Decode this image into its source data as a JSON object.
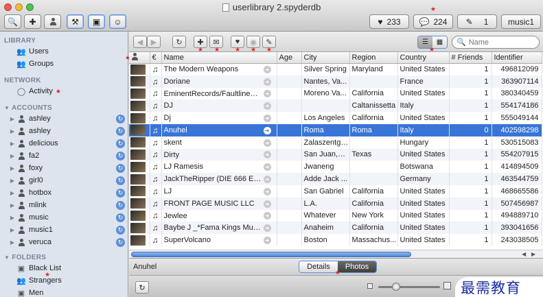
{
  "window": {
    "title": "userlibrary 2.spyderdb",
    "toolbar": {
      "likes_count": "233",
      "comments_count": "224",
      "edits_count": "1",
      "account_label": "music1"
    }
  },
  "sidebar": {
    "library_header": "LIBRARY",
    "library_items": [
      {
        "label": "Users",
        "icon": "users-icon"
      },
      {
        "label": "Groups",
        "icon": "groups-icon"
      }
    ],
    "network_header": "NETWORK",
    "network_items": [
      {
        "label": "Activity",
        "icon": "activity-icon"
      }
    ],
    "accounts_header": "ACCOUNTS",
    "accounts": [
      "ashley",
      "ashley",
      "delicious",
      "fa2",
      "foxy",
      "girl0",
      "hotbox",
      "mlink",
      "music",
      "music1",
      "veruca"
    ],
    "folders_header": "FOLDERS",
    "folders": [
      {
        "label": "Black List",
        "icon": "blacklist-icon"
      },
      {
        "label": "Strangers",
        "icon": "strangers-icon"
      },
      {
        "label": "Men",
        "icon": "folder-icon"
      }
    ]
  },
  "search": {
    "placeholder": "Name"
  },
  "table": {
    "columns": [
      "Name",
      "Age",
      "City",
      "Region",
      "Country",
      "# Friends",
      "Identifier"
    ],
    "rows": [
      {
        "name": "The Modern Weapons",
        "age": "",
        "city": "Silver Spring",
        "region": "Maryland",
        "country": "United States",
        "friends": "1",
        "id": "496812099"
      },
      {
        "name": "Doriane",
        "age": "",
        "city": "Nantes, Va...",
        "region": "",
        "country": "France",
        "friends": "1",
        "id": "363907114"
      },
      {
        "name": "EminentRecords/FaultlinePr...",
        "age": "",
        "city": "Moreno Va...",
        "region": "California",
        "country": "United States",
        "friends": "1",
        "id": "380340459"
      },
      {
        "name": "DJ",
        "age": "",
        "city": "",
        "region": "Caltanissetta",
        "country": "Italy",
        "friends": "1",
        "id": "554174186"
      },
      {
        "name": "Dj",
        "age": "",
        "city": "Los Angeles",
        "region": "California",
        "country": "United States",
        "friends": "1",
        "id": "555049144"
      },
      {
        "name": "Anuhel",
        "age": "",
        "city": "Roma",
        "region": "Roma",
        "country": "Italy",
        "friends": "0",
        "id": "402598298"
      },
      {
        "name": "skent",
        "age": "",
        "city": "Zalaszentgrót",
        "region": "",
        "country": "Hungary",
        "friends": "1",
        "id": "530515083"
      },
      {
        "name": "Dirty",
        "age": "",
        "city": "San Juan,W...",
        "region": "Texas",
        "country": "United States",
        "friends": "1",
        "id": "554207915"
      },
      {
        "name": "LJ Ramesis",
        "age": "",
        "city": "Jwaneng",
        "region": "",
        "country": "Botswana",
        "friends": "1",
        "id": "414894509"
      },
      {
        "name": "JackTheRipper (DIE 666 EP J...",
        "age": "",
        "city": "Adde Jack ...",
        "region": "",
        "country": "Germany",
        "friends": "1",
        "id": "463544759"
      },
      {
        "name": "LJ",
        "age": "",
        "city": "San Gabriel",
        "region": "California",
        "country": "United States",
        "friends": "1",
        "id": "468665586"
      },
      {
        "name": "FRONT PAGE MUSIC LLC",
        "age": "",
        "city": "L.A.",
        "region": "California",
        "country": "United States",
        "friends": "1",
        "id": "507456987"
      },
      {
        "name": "Jewlee",
        "age": "",
        "city": "Whatever",
        "region": "New York",
        "country": "United States",
        "friends": "1",
        "id": "494889710"
      },
      {
        "name": "Baybe J _*Fama Kings Music*_",
        "age": "",
        "city": "Anaheim",
        "region": "California",
        "country": "United States",
        "friends": "1",
        "id": "393041656"
      },
      {
        "name": "SuperVolcano",
        "age": "",
        "city": "Boston",
        "region": "Massachus...",
        "country": "United States",
        "friends": "1",
        "id": "243038505"
      }
    ],
    "selected_index": 5
  },
  "detail": {
    "selected_name": "Anuhel",
    "tabs": [
      "Details",
      "Photos"
    ],
    "active_tab": "Photos"
  },
  "watermark": "最需教育",
  "colors": {
    "selection": "#3875d7",
    "accent": "#5d8fd6",
    "sidebar_bg": "#dde4ed",
    "marker": "#e02424"
  }
}
